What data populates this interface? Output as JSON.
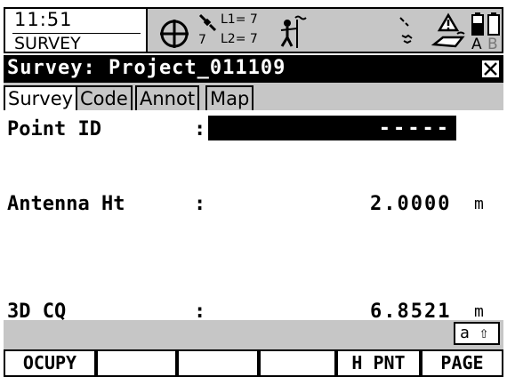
{
  "status": {
    "time": "11:51",
    "mode": "SURVEY",
    "satellites": {
      "visible": "7",
      "l1": "L1= 7",
      "l2": "L2= 7"
    },
    "rtk_device_icon": "rover-station-icon",
    "battery": {
      "labels": [
        "A",
        "B"
      ]
    }
  },
  "title": {
    "text": "Survey: Project_011109"
  },
  "tabs": [
    {
      "label": "Survey",
      "active": true
    },
    {
      "label": "Code",
      "active": false
    },
    {
      "label": "Annot",
      "active": false
    },
    {
      "label": "Map",
      "active": false
    }
  ],
  "fields": {
    "point_id": {
      "label": "Point ID",
      "colon": ":",
      "value": "-----"
    },
    "antenna_ht": {
      "label": "Antenna Ht",
      "colon": ":",
      "value": "2.0000",
      "unit": "m"
    },
    "cq3d": {
      "label": "3D CQ",
      "colon": ":",
      "value": "6.8521",
      "unit": "m"
    }
  },
  "keystate": {
    "text": "a ⇧"
  },
  "fkeys": [
    {
      "label": "OCUPY"
    },
    {
      "label": ""
    },
    {
      "label": ""
    },
    {
      "label": ""
    },
    {
      "label": "H PNT"
    },
    {
      "label": "PAGE"
    }
  ],
  "colors": {
    "panel_gray": "#c6c6c6",
    "title_bg": "#000000",
    "title_fg": "#ffffff"
  }
}
